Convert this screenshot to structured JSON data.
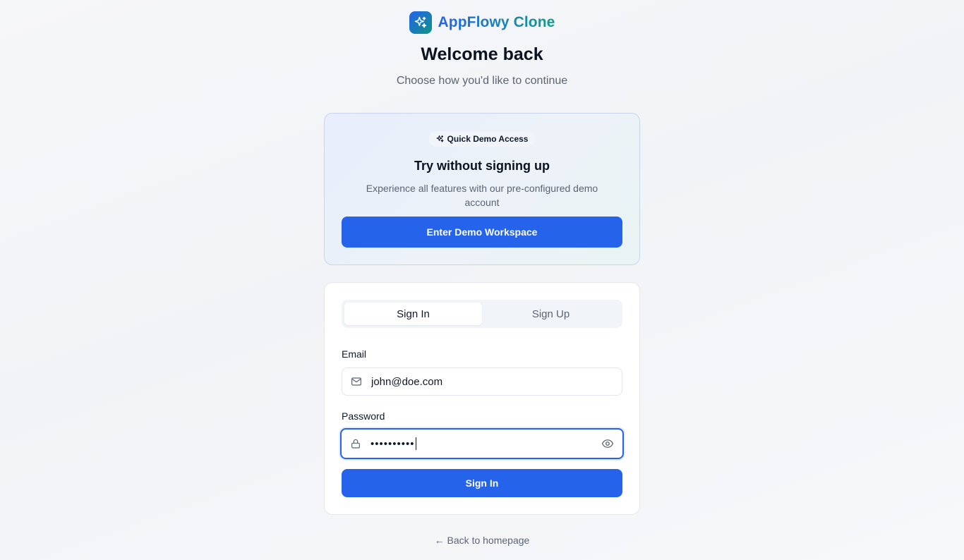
{
  "brand": {
    "name": "AppFlowy Clone",
    "icon": "sparkles-icon"
  },
  "header": {
    "title": "Welcome back",
    "subtitle": "Choose how you'd like to continue"
  },
  "demo": {
    "badge_icon": "sparkles-icon",
    "badge_label": "Quick Demo Access",
    "heading": "Try without signing up",
    "description": "Experience all features with our pre-configured demo account",
    "button_label": "Enter Demo Workspace"
  },
  "auth": {
    "tabs": [
      {
        "label": "Sign In",
        "active": true
      },
      {
        "label": "Sign Up",
        "active": false
      }
    ],
    "email": {
      "label": "Email",
      "value": "john@doe.com",
      "icon": "mail-icon"
    },
    "password": {
      "label": "Password",
      "masked_value": "••••••••••",
      "icon": "lock-icon",
      "toggle_icon": "eye-icon"
    },
    "submit_label": "Sign In"
  },
  "footer": {
    "back_link": "← Back to homepage"
  },
  "colors": {
    "primary": "#2563eb",
    "brand_gradient_end": "#0d9488",
    "muted_text": "#5b6474"
  }
}
